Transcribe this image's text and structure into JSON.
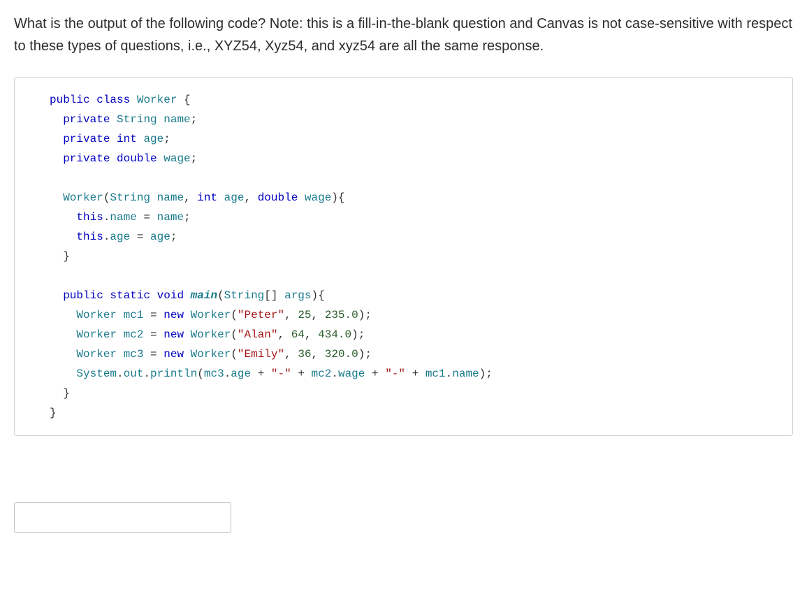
{
  "question": {
    "prompt": "What is the output of the following code? Note: this is a fill-in-the-blank question and Canvas is not case-sensitive with respect to these types of questions, i.e., XYZ54, Xyz54, and xyz54 are all the same response."
  },
  "code": {
    "l1_kw_public": "public",
    "l1_kw_class": "class",
    "l1_classname": "Worker",
    "l1_brace": " {",
    "l2_kw_private": "private",
    "l2_type": "String",
    "l2_name": "name",
    "l3_kw_private": "private",
    "l3_type": "int",
    "l3_name": "age",
    "l4_kw_private": "private",
    "l4_type": "double",
    "l4_name": "wage",
    "l6_ctor": "Worker",
    "l6_p1_type": "String",
    "l6_p1_name": "name",
    "l6_p2_type": "int",
    "l6_p2_name": "age",
    "l6_p3_type": "double",
    "l6_p3_name": "wage",
    "l7_this": "this",
    "l7_field": "name",
    "l7_rhs": "name",
    "l8_this": "this",
    "l8_field": "age",
    "l8_rhs": "age",
    "l9_brace": "}",
    "l11_kw_public": "public",
    "l11_kw_static": "static",
    "l11_kw_void": "void",
    "l11_method": "main",
    "l11_argtype": "String",
    "l11_argname": "args",
    "l12_type": "Worker",
    "l12_var": "mc1",
    "l12_kw_new": "new",
    "l12_ctor": "Worker",
    "l12_arg_str": "\"Peter\"",
    "l12_arg_n1": "25",
    "l12_arg_n2": "235.0",
    "l13_type": "Worker",
    "l13_var": "mc2",
    "l13_kw_new": "new",
    "l13_ctor": "Worker",
    "l13_arg_str": "\"Alan\"",
    "l13_arg_n1": "64",
    "l13_arg_n2": "434.0",
    "l14_type": "Worker",
    "l14_var": "mc3",
    "l14_kw_new": "new",
    "l14_ctor": "Worker",
    "l14_arg_str": "\"Emily\"",
    "l14_arg_n1": "36",
    "l14_arg_n2": "320.0",
    "l15_sys": "System",
    "l15_out": "out",
    "l15_println": "println",
    "l15_obj1": "mc3",
    "l15_f1": "age",
    "l15_dash1": "\"-\"",
    "l15_obj2": "mc2",
    "l15_f2": "wage",
    "l15_dash2": "\"-\"",
    "l15_obj3": "mc1",
    "l15_f3": "name",
    "l16_brace": "}",
    "l17_brace": "}"
  },
  "answer": {
    "value": "",
    "placeholder": ""
  }
}
